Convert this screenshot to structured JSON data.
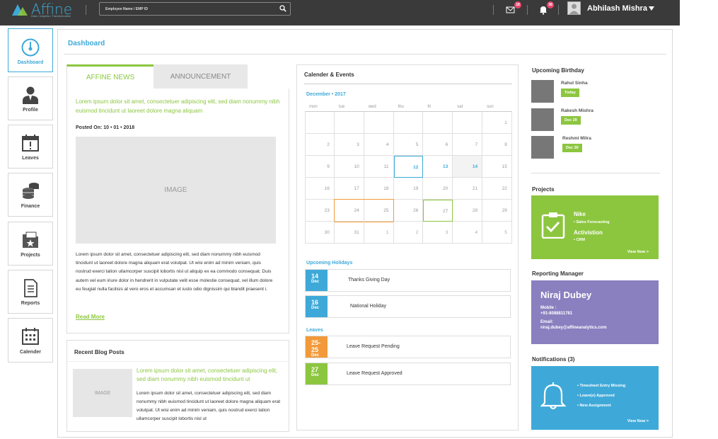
{
  "header": {
    "logo_text": "Affine",
    "logo_tagline": "Data • Insights • Transformation",
    "search_placeholder": "Employee Name / EMP ID",
    "mail_badge": "18",
    "notify_badge": "38",
    "username": "Abhilash Mishra"
  },
  "sidebar": {
    "items": [
      {
        "label": "Dashboard",
        "icon": "dashboard-gauge-icon"
      },
      {
        "label": "Profile",
        "icon": "profile-person-icon"
      },
      {
        "label": "Leaves",
        "icon": "calendar-alert-icon"
      },
      {
        "label": "Finance",
        "icon": "coins-stack-icon"
      },
      {
        "label": "Projects",
        "icon": "folder-star-icon"
      },
      {
        "label": "Reports",
        "icon": "document-icon"
      },
      {
        "label": "Calender",
        "icon": "calendar-grid-icon"
      }
    ]
  },
  "page": {
    "title": "Dashboard"
  },
  "news": {
    "tabs": [
      "AFFINE NEWS",
      "ANNOUNCEMENT"
    ],
    "lead": "Lorem ipsum dolor sit amet, consectetuer adipiscing elit, sed diam nonummy nibh euismod tincidunt ut laoreet dolore magna aliquam",
    "posted": "Posted On: 10 • 01 • 2018",
    "image_label": "IMAGE",
    "body": "Lorem ipsum dolor sit amet, consectetuer adipiscing elit, sed diam nonummy nibh euismod tincidunt ut laoreet dolore magna aliquam erat volutpat. Ut wisi enim ad minim veniam, quis nostrud exerci tation ullamcorper suscipit lobortis nisl ut aliquip ex ea commodo consequat. Duis autem vel eum iriure dolor in hendrerit in vulputate velit esse molestie consequat, vel illum dolore eu feugiat nulla facilisis at vero eros et accumsan et iusto odio dignissim qui blandit praesent i.",
    "read_more": "Read More"
  },
  "blog": {
    "title": "Recent Blog Posts",
    "image_label": "IMAGE",
    "lead": "Lorem ipsum dolor sit amet, consectetuer adipiscing elit, sed diam nonummy nibh euismod tincidunt ut",
    "body": "Lorem ipsum dolor sit amet, consectetuer adipiscing elit, sed diam nonummy nibh euismod tincidunt ut laoreet dolore magna aliquam erat volutpat. Ut wisi enim ad minim veniam, quis nostrud exerci tation ullamcorper suscipit lobortis nisl ut"
  },
  "calendar": {
    "title": "Calender & Events",
    "month": "December • 2017",
    "weekdays": [
      "mon",
      "tue",
      "wed",
      "thu",
      "fri",
      "sat",
      "sun"
    ],
    "weeks": [
      [
        "",
        "",
        "",
        "",
        "",
        "",
        "1"
      ],
      [
        "2",
        "3",
        "4",
        "5",
        "6",
        "7",
        "8"
      ],
      [
        "9",
        "10",
        "11",
        "12",
        "13",
        "14",
        "15"
      ],
      [
        "16",
        "17",
        "18",
        "19",
        "20",
        "21",
        "22"
      ],
      [
        "23",
        "24",
        "25",
        "26",
        "27",
        "28",
        "29"
      ],
      [
        "30",
        "31",
        "1",
        "2",
        "3",
        "4",
        "5"
      ]
    ],
    "holidays_title": "Upcoming Holidays",
    "holidays": [
      {
        "day": "14",
        "month": "Dec",
        "text": "Thanks Giving Day",
        "color": "#3ea9d8"
      },
      {
        "day": "16",
        "month": "Dec",
        "text": "National Holiday",
        "color": "#3ea9d8"
      }
    ],
    "leaves_title": "Leaves",
    "leaves": [
      {
        "day": "25-25",
        "month": "Dec",
        "text": "Leave Request Pending",
        "color": "#f29a3b"
      },
      {
        "day": "27",
        "month": "Dec",
        "text": "Leave Request  Approved",
        "color": "#8cc63f"
      }
    ]
  },
  "birthdays": {
    "title": "Upcoming Birthday",
    "items": [
      {
        "name": "Rahul Sinha",
        "tag": "Today"
      },
      {
        "name": "Rakesh Mishra",
        "tag": "Dec 29"
      },
      {
        "name": "Reshmi Mitra",
        "tag": "Dec 30"
      }
    ]
  },
  "projects": {
    "title": "Projects",
    "name1": "Nike",
    "sub1": "• Sales Forecasting",
    "name2": "Activistion",
    "sub2": "• CRM",
    "link": "View Now >"
  },
  "manager": {
    "title": "Reporting Manager",
    "name": "Niraj Dubey",
    "mobile_label": "Mobile :",
    "mobile": "+91-8088811781",
    "email_label": "Email:",
    "email": "niraj.dubey@affineanalytics.com"
  },
  "notifications": {
    "title": "Notifications (3)",
    "items": [
      "• Timesheet Entry Missing",
      "• Leave(s)  Approved",
      "• New Assignment"
    ],
    "link": "View Now >"
  },
  "colors": {
    "accent": "#3ea9d8",
    "green": "#8cc63f",
    "orange": "#f29a3b",
    "purple": "#8a7fbf",
    "topbar": "#3a3a3a"
  }
}
